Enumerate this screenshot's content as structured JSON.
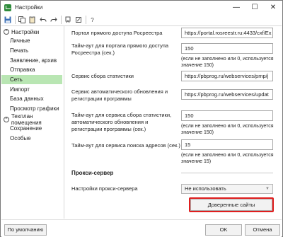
{
  "window": {
    "title": "Настройки",
    "controls": {
      "minimize": "—",
      "maximize": "☐",
      "close": "✕"
    }
  },
  "toolbar": {
    "buttons": [
      "save-icon",
      "copy-icon",
      "paste-icon",
      "undo-icon",
      "redo-icon",
      "cut-icon",
      "clear-icon",
      "help-icon"
    ],
    "help_label": "?"
  },
  "sidebar": {
    "groups": [
      {
        "title": "Настройки",
        "items": [
          "Личные",
          "Печать",
          "Заявление, архив",
          "Отправка",
          "Сеть",
          "Импорт",
          "База данных",
          "Просмотр графики"
        ]
      },
      {
        "title": "Техплан помещения",
        "items": [
          "Сохранение",
          "Особые"
        ]
      }
    ],
    "active_item": "Сеть",
    "collapse_symbol": "^"
  },
  "form": {
    "portal_label": "Портал прямого доступа Росреестра",
    "portal_value": "https://portal.rosreestr.ru:4433/cxf/Ex",
    "portal_timeout_label": "Тайм-аут для портала прямого доступа Росреестра (сек.)",
    "portal_timeout_value": "150",
    "portal_timeout_hint": "(если не заполнено или 0, используется значение 150)",
    "stats_label": "Сервис сбора статистики",
    "stats_value": "https://pbprog.ru/webservices/pmp/j",
    "update_label": "Сервис автоматического обновления и регистрации программы",
    "update_value": "https://pbprog.ru/webservices/updat",
    "stats_timeout_label": "Тайм-аут для сервиса сбора статистики, автоматического обновления и регистрации программы (сек.)",
    "stats_timeout_value": "150",
    "stats_timeout_hint": "(если не заполнено или 0, используется значение 150)",
    "address_timeout_label": "Тайм-аут для сервиса поиска адресов (сек.)",
    "address_timeout_value": "15",
    "address_timeout_hint": "(если не заполнено или 0, используется значение 15)",
    "proxy_section": "Прокси-сервер",
    "proxy_label": "Настройки прокси-сервера",
    "proxy_value": "Не использовать",
    "trusted_sites_button": "Доверенные сайты"
  },
  "footer": {
    "default_button": "По умолчанию",
    "ok_button": "OK",
    "cancel_button": "Отмена"
  },
  "colors": {
    "active_item_bg": "#b9e6b3",
    "highlight_border": "#e01e1e"
  }
}
